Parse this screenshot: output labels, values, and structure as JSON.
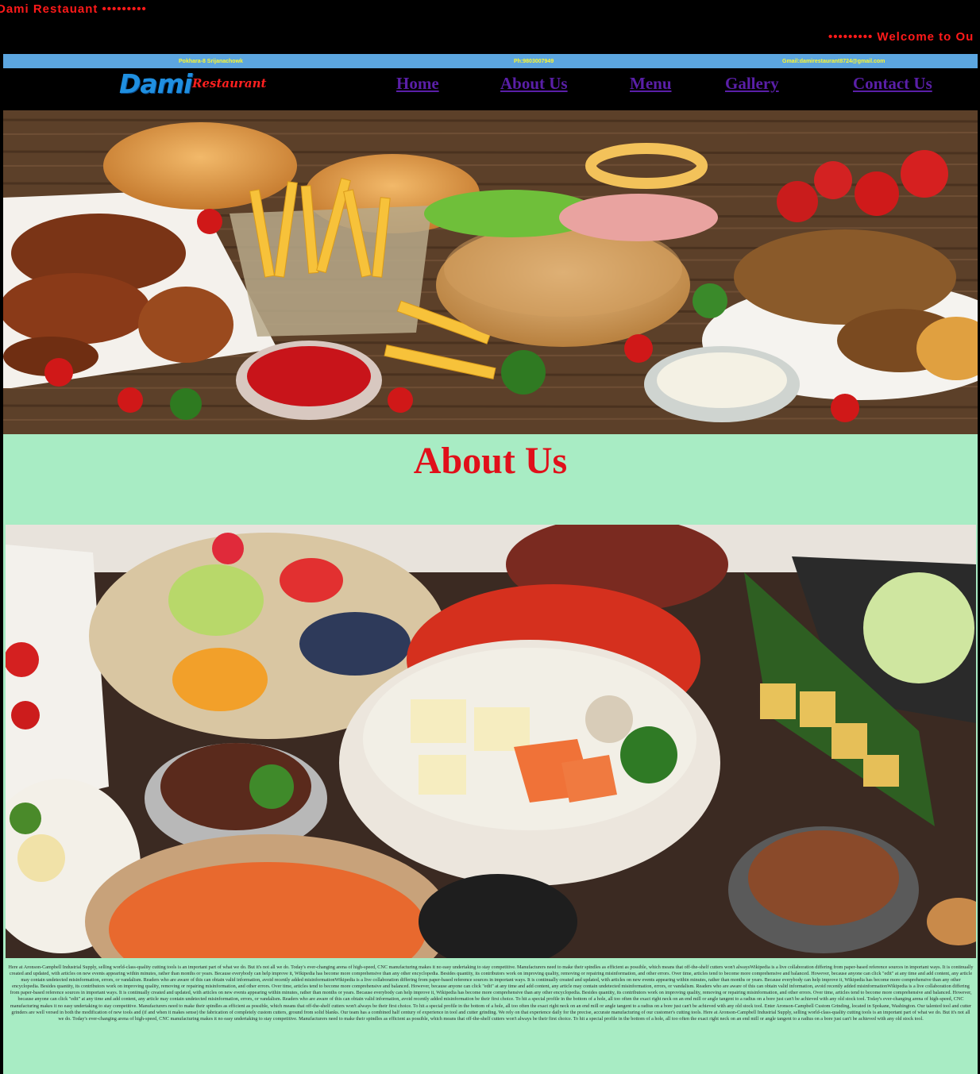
{
  "marquee": {
    "left_text": "Dami  Restauant  •••••••••",
    "right_text": "•••••••••  Welcome  to  Ou"
  },
  "info": {
    "address": "Pokhara-8  Srijanachowk",
    "phone": "Ph:9803007949",
    "email": "Gmail:damirestaurant8724@gmail.com"
  },
  "logo": {
    "main": "Dami",
    "sub": "Restaurant"
  },
  "nav": {
    "items": [
      {
        "label": "Home"
      },
      {
        "label": "About Us"
      },
      {
        "label": "Menu"
      },
      {
        "label": "Gallery"
      },
      {
        "label": "Contact Us"
      }
    ]
  },
  "about": {
    "title": "About Us",
    "body": "Here at Aronson-Campbell Industrial Supply, selling world-class-quality cutting tools is an important part of what we do. But it's not all we do. Today's ever-changing arena of high-speed, CNC manufacturing makes it no easy undertaking to stay competitive. Manufacturers need to make their spindles as efficient as possible, which means that off-the-shelf cutters won't alwaysWikipedia is a live collaboration differing from paper-based reference sources in important ways. It is continually created and updated, with articles on new events appearing within minutes, rather than months or years. Because everybody can help improve it, Wikipedia has become more comprehensive than any other encyclopedia. Besides quantity, its contributors work on improving quality, removing or repairing misinformation, and other errors. Over time, articles tend to become more comprehensive and balanced. However, because anyone can click \"edit\" at any time and add content, any article may contain undetected misinformation, errors, or vandalism. Readers who are aware of this can obtain valid information, avoid recently added misinformationWikipedia is a live collaboration differing from paper-based reference sources in important ways. It is continually created and updated, with articles on new events appearing within minutes, rather than months or years. Because everybody can help improve it, Wikipedia has become more comprehensive than any other encyclopedia. Besides quantity, its contributors work on improving quality, removing or repairing misinformation, and other errors. Over time, articles tend to become more comprehensive and balanced. However, because anyone can click \"edit\" at any time and add content, any article may contain undetected misinformation, errors, or vandalism. Readers who are aware of this can obtain valid information, avoid recently added misinformationWikipedia is a live collaboration differing from paper-based reference sources in important ways. It is continually created and updated, with articles on new events appearing within minutes, rather than months or years. Because everybody can help improve it, Wikipedia has become more comprehensive than any other encyclopedia. Besides quantity, its contributors work on improving quality, removing or repairing misinformation, and other errors. Over time, articles tend to become more comprehensive and balanced. However, because anyone can click \"edit\" at any time and add content, any article may contain undetected misinformation, errors, or vandalism. Readers who are aware of this can obtain valid information, avoid recently added misinformation be their first choice. To hit a special profile in the bottom of a hole, all too often the exact right neck on an end mill or angle tangent to a radius on a bore just can't be achieved with any old stock tool. Today's ever-changing arena of high-speed, CNC manufacturing makes it no easy undertaking to stay competitive. Manufacturers need to make their spindles as efficient as possible, which means that off-the-shelf cutters won't always be their first choice. To hit a special profile in the bottom of a hole, all too often the exact right neck on an end mill or angle tangent to a radius on a bore just can't be achieved with any old stock tool. Enter Aronson-Campbell Custom Grinding, located in Spokane, Washington. Our talented tool and cutter grinders are well versed in both the modification of new tools and (if and when it makes sense) the fabrication of completely custom cutters, ground from solid blanks. Our team has a combined half century of experience in tool and cutter grinding. We rely on that experience daily for the precise, accurate manufacturing of our customer's cutting tools. Here at Aronson-Campbell Industrial Supply, selling world-class-quality cutting tools is an important part of what we do. But it's not all we do. Today's ever-changing arena of high-speed, CNC manufacturing makes it no easy undertaking to stay competitive. Manufacturers need to make their spindles as efficient as possible, which means that off-the-shelf cutters won't always be their first choice. To hit a special profile in the bottom of a hole, all too often the exact right neck on an end mill or angle tangent to a radius on a bore just can't be achieved with any old stock tool."
  }
}
